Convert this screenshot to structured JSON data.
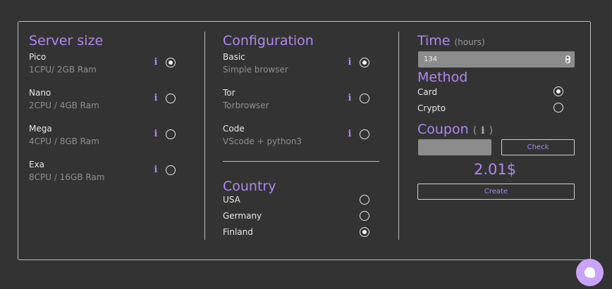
{
  "server_size": {
    "heading": "Server size",
    "options": [
      {
        "title": "Pico",
        "desc": "1CPU/ 2GB Ram",
        "checked": true
      },
      {
        "title": "Nano",
        "desc": "2CPU / 4GB Ram",
        "checked": false
      },
      {
        "title": "Mega",
        "desc": "4CPU / 8GB Ram",
        "checked": false
      },
      {
        "title": "Exa",
        "desc": "8CPU / 16GB Ram",
        "checked": false
      }
    ]
  },
  "configuration": {
    "heading": "Configuration",
    "options": [
      {
        "title": "Basic",
        "desc": "Simple browser",
        "checked": true
      },
      {
        "title": "Tor",
        "desc": "Torbrowser",
        "checked": false
      },
      {
        "title": "Code",
        "desc": "VScode + python3",
        "checked": false
      }
    ]
  },
  "country": {
    "heading": "Country",
    "options": [
      {
        "label": "USA",
        "checked": false
      },
      {
        "label": "Germany",
        "checked": false
      },
      {
        "label": "Finland",
        "checked": true
      }
    ]
  },
  "time": {
    "heading": "Time",
    "unit": "(hours)",
    "value": "134"
  },
  "method": {
    "heading": "Method",
    "options": [
      {
        "label": "Card",
        "checked": true
      },
      {
        "label": "Crypto",
        "checked": false
      }
    ]
  },
  "coupon": {
    "heading": "Coupon",
    "paren_open": "(",
    "paren_close": ")",
    "value": "",
    "check_label": "Check"
  },
  "price": "2.01$",
  "create_label": "Create",
  "info_glyph": "i",
  "colors": {
    "accent": "#b088f0",
    "background": "#333333",
    "chat_button": "#c9a3fa"
  }
}
